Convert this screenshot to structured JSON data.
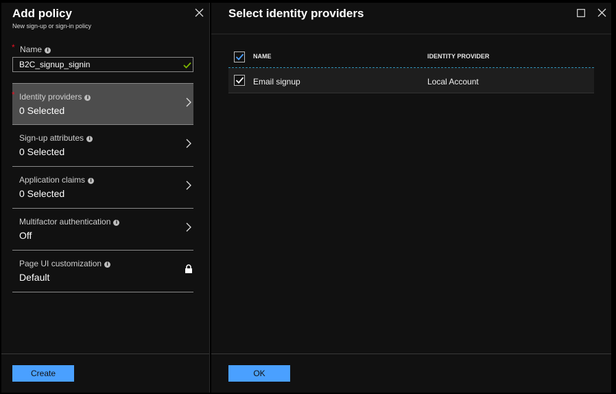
{
  "left_blade": {
    "title": "Add policy",
    "subtitle": "New sign-up or sign-in policy",
    "name_field": {
      "label": "Name",
      "value": "B2C_signup_signin"
    },
    "settings": [
      {
        "label": "Identity providers",
        "value": "0 Selected",
        "selected": true,
        "required": true
      },
      {
        "label": "Sign-up attributes",
        "value": "0 Selected"
      },
      {
        "label": "Application claims",
        "value": "0 Selected"
      },
      {
        "label": "Multifactor authentication",
        "value": "Off"
      },
      {
        "label": "Page UI customization",
        "value": "Default",
        "locked": true
      }
    ],
    "create_label": "Create"
  },
  "right_blade": {
    "title": "Select identity providers",
    "columns": [
      "NAME",
      "IDENTITY PROVIDER"
    ],
    "rows": [
      {
        "name": "Email signup",
        "provider": "Local Account",
        "checked": true
      }
    ],
    "ok_label": "OK"
  },
  "colors": {
    "accent": "#4aa0ff",
    "required": "#e81123",
    "valid": "#7fba00",
    "selected_row": "#4d4d4d",
    "checkbox_check": "#4aa0ff"
  },
  "icons": [
    "close-icon",
    "maximize-icon",
    "info-icon",
    "chevron-right-icon",
    "lock-icon",
    "checkmark-icon",
    "checkbox-icon"
  ]
}
